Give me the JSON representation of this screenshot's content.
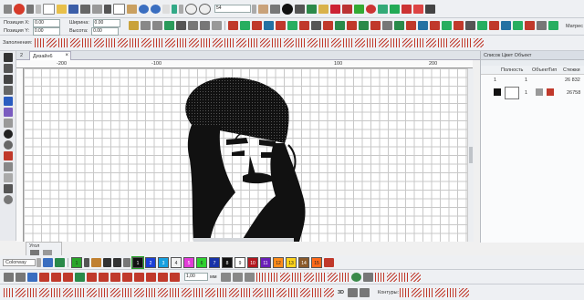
{
  "toolbar1": {
    "pos_x_label": "Позиция X:",
    "pos_x_value": "0.00",
    "pos_y_label": "Позиция Y:",
    "pos_y_value": "0.00",
    "width_label": "Ширина:",
    "width_value": "0.00",
    "height_label": "Высота:",
    "height_value": "0.00",
    "zoom_value": "54",
    "pattern_label": "Матрес"
  },
  "toolbar2": {
    "fill_label": "Заполнения:"
  },
  "tabs": {
    "num_label": "2",
    "design_tab": "Дизайн6"
  },
  "ruler": {
    "ticks": [
      "-200",
      "-100",
      "100",
      "200"
    ]
  },
  "right_panel": {
    "title": "Список Цвет Объект",
    "columns": [
      "Полность",
      "Объект",
      "Тип",
      "Стежки"
    ],
    "rows": [
      {
        "num": "1",
        "count": "1",
        "stitches": "26 832"
      },
      {
        "num": "1",
        "count": "1",
        "stitches": "26758"
      }
    ]
  },
  "bottom_left": {
    "panel_tab": "Угол",
    "colorway_label": "Colorway",
    "size_value": "1,00",
    "size_unit": "мм"
  },
  "palette": {
    "colors": [
      {
        "num": "1",
        "hex": "#2aa52a"
      },
      {
        "num": "1",
        "hex": "#111111"
      },
      {
        "num": "2",
        "hex": "#1c3fd6"
      },
      {
        "num": "3",
        "hex": "#18a0e0"
      },
      {
        "num": "4",
        "hex": "#f2f2f2"
      },
      {
        "num": "5",
        "hex": "#e23bd8"
      },
      {
        "num": "6",
        "hex": "#2fd12f"
      },
      {
        "num": "7",
        "hex": "#1833a8"
      },
      {
        "num": "8",
        "hex": "#111111"
      },
      {
        "num": "9",
        "hex": "#ffffff"
      },
      {
        "num": "10",
        "hex": "#b3171f"
      },
      {
        "num": "11",
        "hex": "#6a1fb8"
      },
      {
        "num": "12",
        "hex": "#ff8c1a"
      },
      {
        "num": "13",
        "hex": "#ffd21a"
      },
      {
        "num": "14",
        "hex": "#8b5a2b"
      },
      {
        "num": "15",
        "hex": "#ff6a1a"
      }
    ]
  },
  "status": {
    "contours_label": "Контуры:",
    "mode_3d": "3D"
  }
}
